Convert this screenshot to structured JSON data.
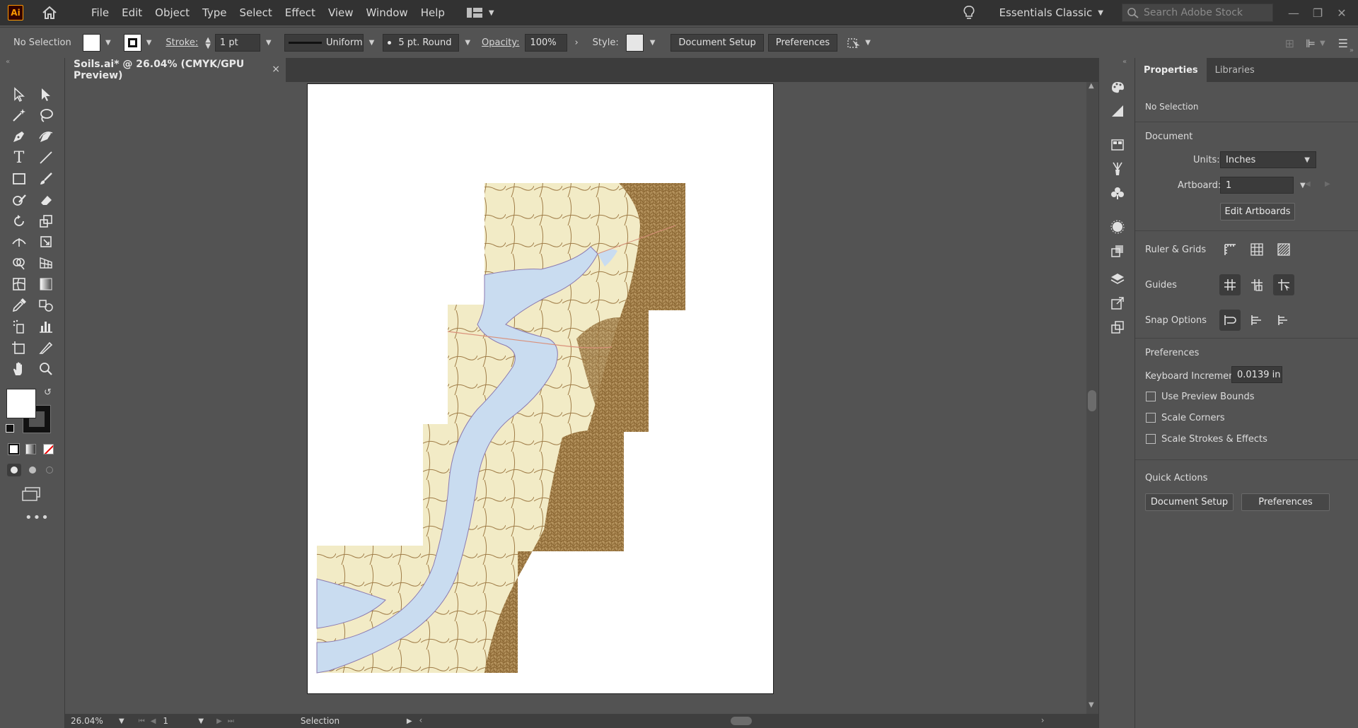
{
  "app": {
    "logo": "Ai"
  },
  "menu": [
    "File",
    "Edit",
    "Object",
    "Type",
    "Select",
    "Effect",
    "View",
    "Window",
    "Help"
  ],
  "workspace": {
    "name": "Essentials Classic",
    "search_placeholder": "Search Adobe Stock"
  },
  "control": {
    "selection_state": "No Selection",
    "stroke_label": "Stroke:",
    "stroke_weight": "1 pt",
    "profile": "Uniform",
    "brush": "5 pt. Round",
    "opacity_label": "Opacity:",
    "opacity": "100%",
    "style_label": "Style:",
    "document_setup": "Document Setup",
    "preferences": "Preferences"
  },
  "document_tab": {
    "title": "Soils.ai* @ 26.04% (CMYK/GPU Preview)",
    "close": "×"
  },
  "status": {
    "zoom": "26.04%",
    "artboard": "1",
    "tool": "Selection"
  },
  "panel": {
    "tabs": [
      "Properties",
      "Libraries"
    ],
    "selection": "No Selection",
    "document_heading": "Document",
    "units_label": "Units:",
    "units_value": "Inches",
    "artboard_label": "Artboard:",
    "artboard_value": "1",
    "edit_artboards": "Edit Artboards",
    "ruler_grids": "Ruler & Grids",
    "guides": "Guides",
    "snap_options": "Snap Options",
    "preferences_heading": "Preferences",
    "keyboard_increment_label": "Keyboard Increment:",
    "keyboard_increment_value": "0.0139 in",
    "use_preview_bounds": "Use Preview Bounds",
    "scale_corners": "Scale Corners",
    "scale_strokes": "Scale Strokes & Effects",
    "quick_actions": "Quick Actions",
    "qa_document_setup": "Document Setup",
    "qa_preferences": "Preferences"
  },
  "colors": {
    "map_fill": "#f2ebbf",
    "map_lines": "#9b7740",
    "water": "#c9dcf0"
  }
}
